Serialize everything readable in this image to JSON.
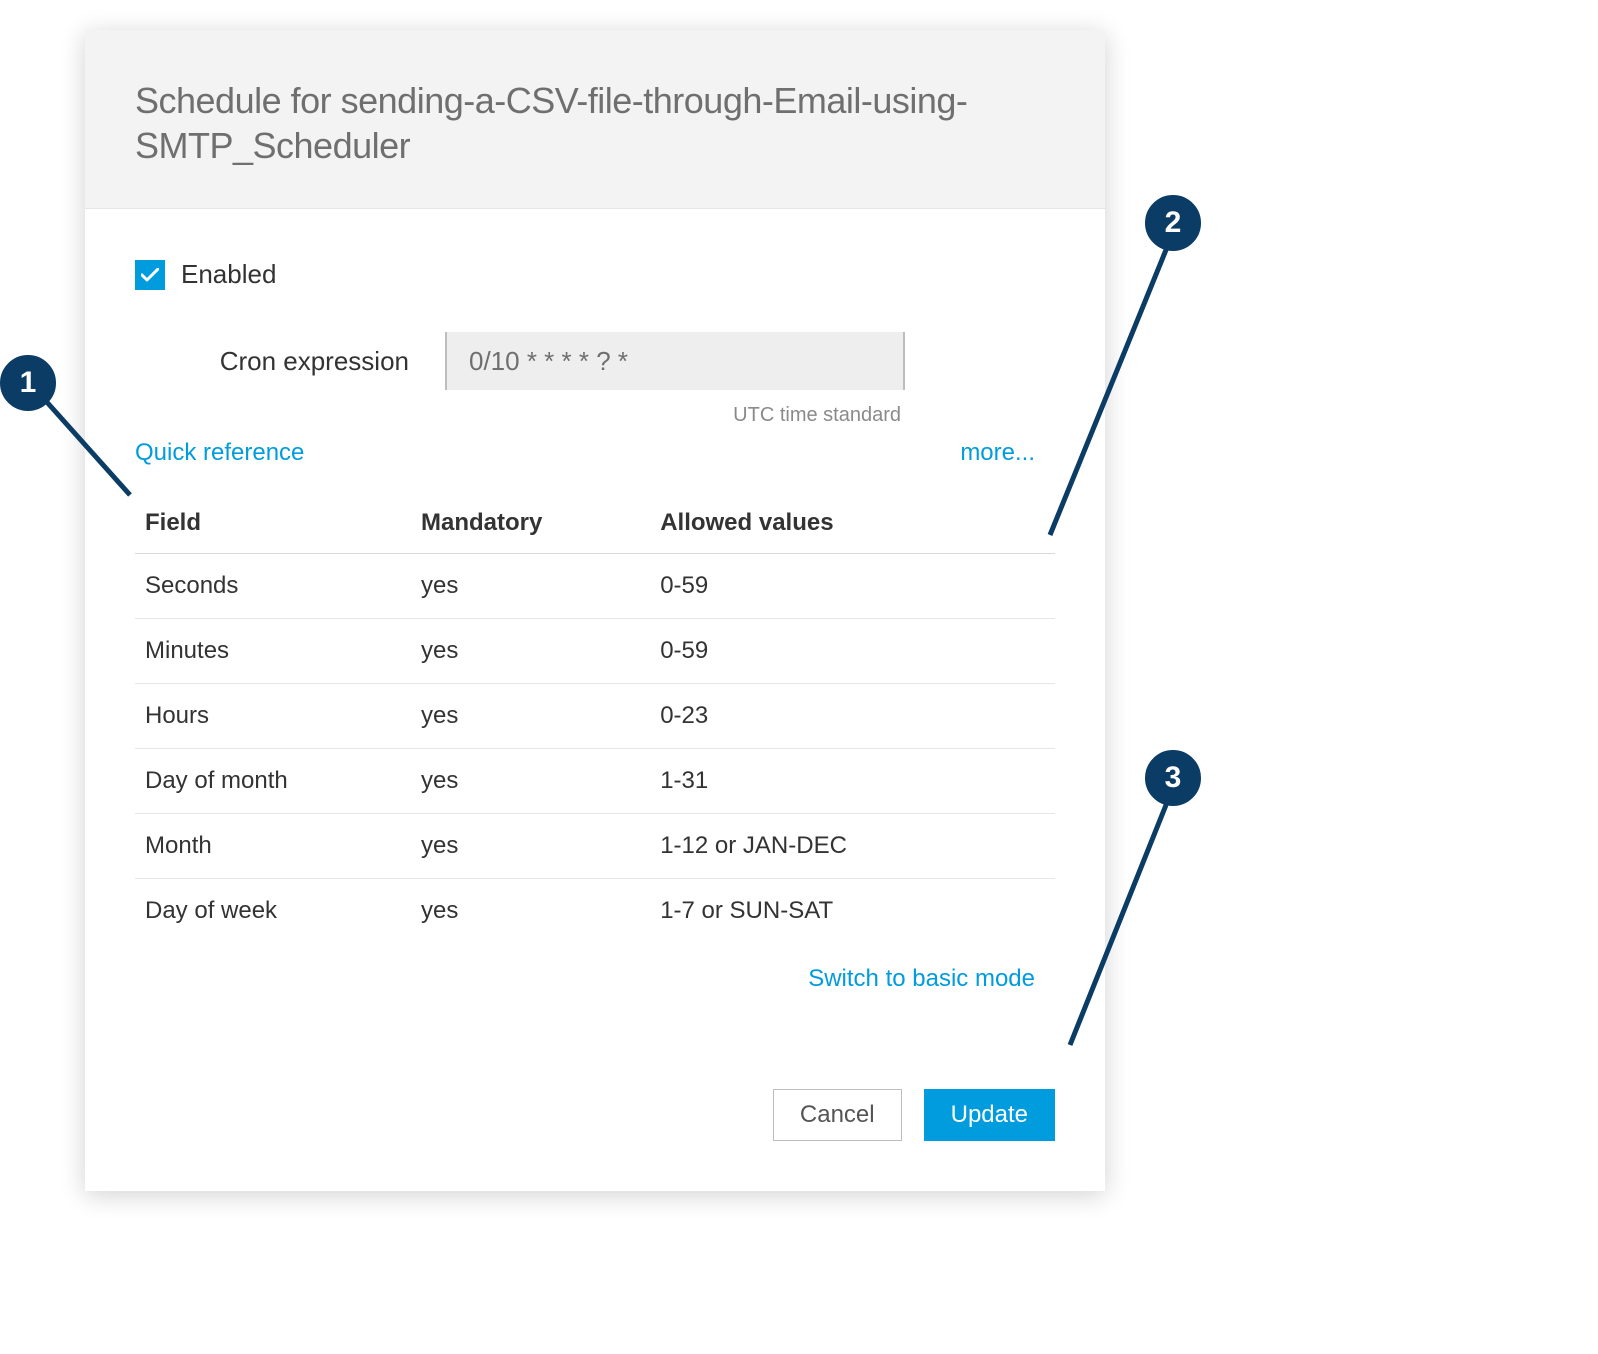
{
  "header": {
    "title": "Schedule for sending-a-CSV-file-through-Email-using-SMTP_Scheduler"
  },
  "enabled": {
    "label": "Enabled",
    "checked": true
  },
  "cron": {
    "label": "Cron expression",
    "value": "0/10 * * * * ? *",
    "utc_note": "UTC time standard"
  },
  "links": {
    "quick_reference": "Quick reference",
    "more": "more...",
    "switch_mode": "Switch to basic mode"
  },
  "ref_table": {
    "headers": {
      "field": "Field",
      "mandatory": "Mandatory",
      "allowed": "Allowed values"
    },
    "rows": [
      {
        "field": "Seconds",
        "mandatory": "yes",
        "allowed": "0-59"
      },
      {
        "field": "Minutes",
        "mandatory": "yes",
        "allowed": "0-59"
      },
      {
        "field": "Hours",
        "mandatory": "yes",
        "allowed": "0-23"
      },
      {
        "field": "Day of month",
        "mandatory": "yes",
        "allowed": "1-31"
      },
      {
        "field": "Month",
        "mandatory": "yes",
        "allowed": "1-12 or JAN-DEC"
      },
      {
        "field": "Day of week",
        "mandatory": "yes",
        "allowed": "1-7 or SUN-SAT"
      }
    ]
  },
  "footer": {
    "cancel": "Cancel",
    "update": "Update"
  },
  "callouts": {
    "c1": "1",
    "c2": "2",
    "c3": "3"
  },
  "colors": {
    "accent": "#009cde",
    "callout": "#0b3c66"
  }
}
